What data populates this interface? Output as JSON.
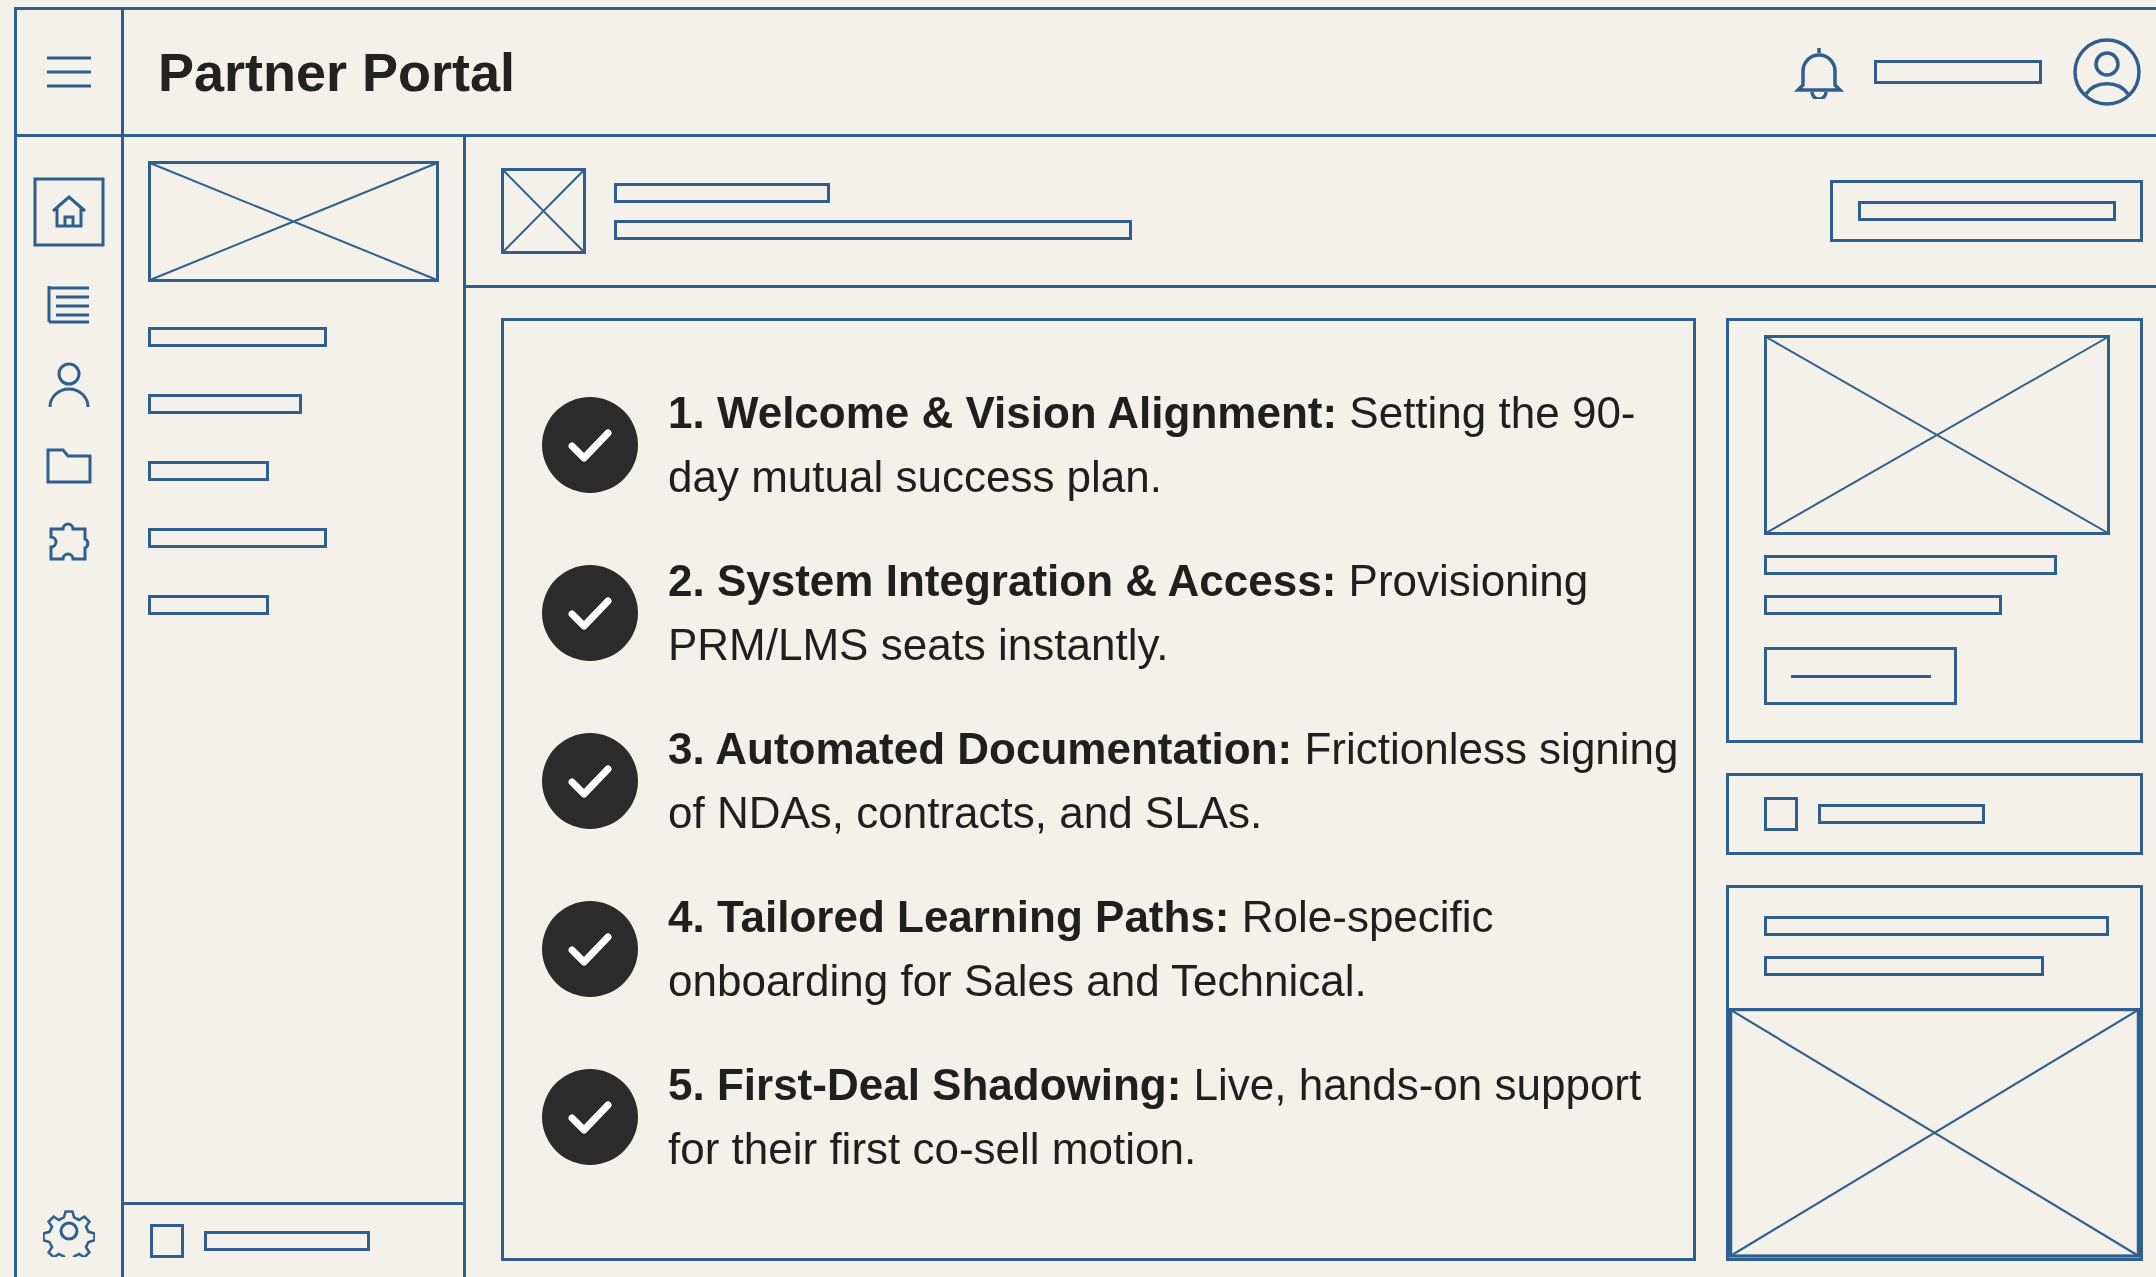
{
  "header": {
    "title": "Partner Portal"
  },
  "steps": [
    {
      "text": "**1. Welcome & Vision Alignment:** Setting the 90-day mutual success plan.",
      "checked": true
    },
    {
      "text": "**2. System Integration & Access:** Provisioning PRM/LMS seats instantly.",
      "checked": true
    },
    {
      "text": "**3. Automated Documentation:** Frictionless signing of NDAs, contracts, and SLAs.",
      "checked": true
    },
    {
      "text": "**4. Tailored Learning Paths:** Role-specific onboarding for Sales and Technical.",
      "checked": true
    },
    {
      "text": "**5. First-Deal Shadowing:** Live, hands-on support for their first co-sell motion.",
      "checked": true
    }
  ]
}
